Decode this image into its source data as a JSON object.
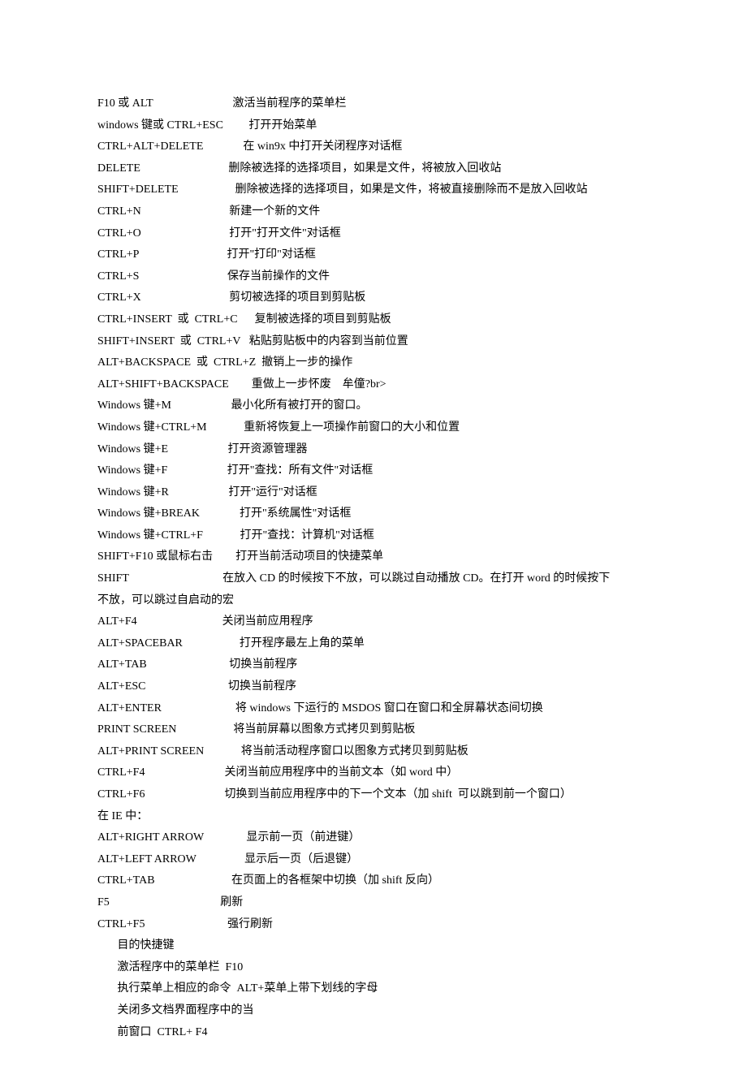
{
  "lines": [
    "F10 或 ALT                            激活当前程序的菜单栏",
    "windows 键或 CTRL+ESC         打开开始菜单",
    "CTRL+ALT+DELETE              在 win9x 中打开关闭程序对话框",
    "DELETE                               删除被选择的选择项目，如果是文件，将被放入回收站",
    "SHIFT+DELETE                    删除被选择的选择项目，如果是文件，将被直接删除而不是放入回收站",
    "CTRL+N                               新建一个新的文件",
    "CTRL+O                               打开\"打开文件\"对话框",
    "CTRL+P                               打开\"打印\"对话框",
    "CTRL+S                               保存当前操作的文件",
    "CTRL+X                               剪切被选择的项目到剪贴板",
    "CTRL+INSERT  或  CTRL+C      复制被选择的项目到剪贴板",
    "SHIFT+INSERT  或  CTRL+V   粘贴剪贴板中的内容到当前位置",
    "ALT+BACKSPACE  或  CTRL+Z  撤销上一步的操作",
    "ALT+SHIFT+BACKSPACE        重做上一步怀废    牟僮?br>",
    "Windows 键+M                     最小化所有被打开的窗口。",
    "Windows 键+CTRL+M             重新将恢复上一项操作前窗口的大小和位置",
    "Windows 键+E                     打开资源管理器",
    "Windows 键+F                     打开\"查找：所有文件\"对话框",
    "Windows 键+R                     打开\"运行\"对话框",
    "Windows 键+BREAK              打开\"系统属性\"对话框",
    "Windows 键+CTRL+F             打开\"查找：计算机\"对话框",
    "SHIFT+F10 或鼠标右击        打开当前活动项目的快捷菜单",
    "SHIFT                                 在放入 CD 的时候按下不放，可以跳过自动播放 CD。在打开 word 的时候按下",
    "不放，可以跳过自启动的宏",
    "ALT+F4                              关闭当前应用程序",
    "ALT+SPACEBAR                    打开程序最左上角的菜单",
    "ALT+TAB                             切换当前程序",
    "ALT+ESC                             切换当前程序",
    "ALT+ENTER                          将 windows 下运行的 MSDOS 窗口在窗口和全屏幕状态间切换",
    "PRINT SCREEN                    将当前屏幕以图象方式拷贝到剪贴板",
    "ALT+PRINT SCREEN             将当前活动程序窗口以图象方式拷贝到剪贴板",
    "CTRL+F4                            关闭当前应用程序中的当前文本（如 word 中）",
    "CTRL+F6                            切换到当前应用程序中的下一个文本（加 shift  可以跳到前一个窗口）",
    "在 IE 中：",
    "ALT+RIGHT ARROW               显示前一页（前进键）",
    "ALT+LEFT ARROW                 显示后一页（后退键）",
    "CTRL+TAB                           在页面上的各框架中切换（加 shift 反向）",
    "F5                                       刷新",
    "CTRL+F5                             强行刷新",
    "       目的快捷键",
    "       激活程序中的菜单栏  F10",
    "       执行菜单上相应的命令  ALT+菜单上带下划线的字母",
    "       关闭多文档界面程序中的当",
    "       前窗口  CTRL+ F4"
  ]
}
